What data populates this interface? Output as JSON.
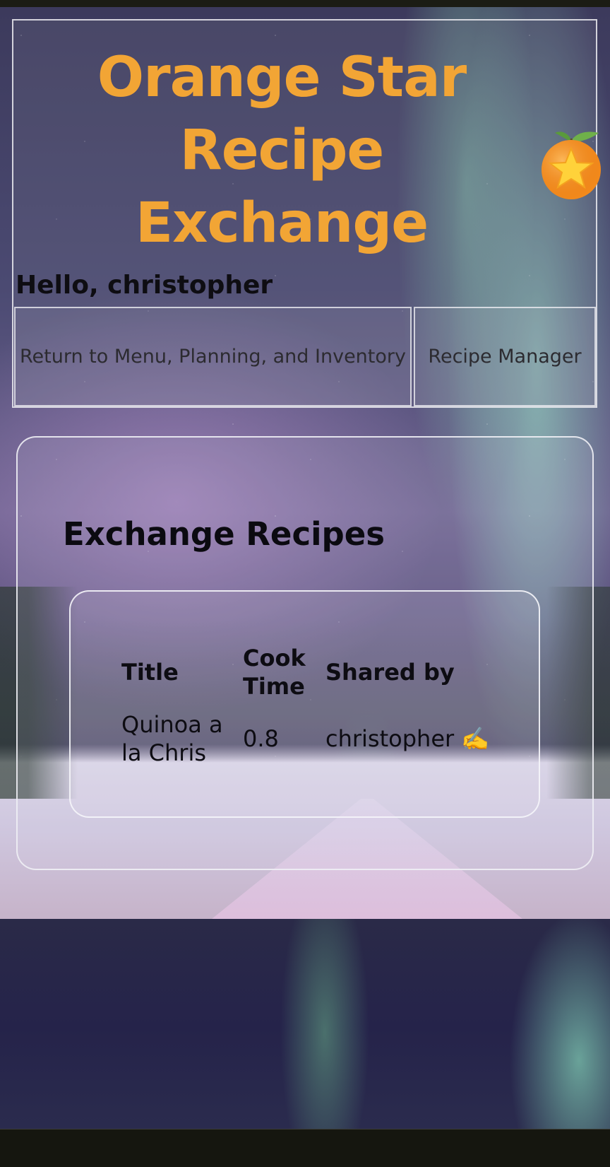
{
  "app": {
    "title": "Orange Star Recipe Exchange",
    "logo_icon": "orange-star-logo-icon",
    "accent_color": "#f2a535"
  },
  "user": {
    "greeting": "Hello, christopher"
  },
  "nav": {
    "menu_label": "Return to Menu, Planning, and Inventory",
    "recipe_manager_label": "Recipe Manager"
  },
  "exchange": {
    "heading": "Exchange Recipes",
    "columns": [
      "Title",
      "Cook Time",
      "Shared by"
    ],
    "rows": [
      {
        "title": "Quinoa a la Chris",
        "cook_time": "0.8",
        "shared_by": "christopher ✍️"
      }
    ]
  }
}
